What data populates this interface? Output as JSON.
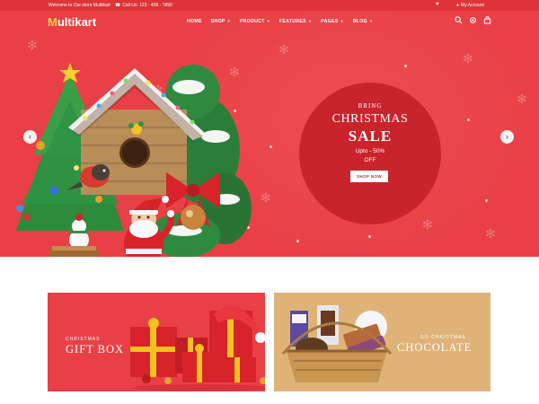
{
  "topbar": {
    "welcome": "Welcome to Our store Multikart",
    "call": "Call Us: 123 - 456 - 7890",
    "account": "My Account"
  },
  "header": {
    "logo_initial": "M",
    "logo_rest": "ultikart",
    "nav": [
      {
        "label": "HOME"
      },
      {
        "label": "SHOP"
      },
      {
        "label": "PRODUCT"
      },
      {
        "label": "FEATURES"
      },
      {
        "label": "PAGES"
      },
      {
        "label": "BLOG"
      }
    ],
    "icons": [
      "search-icon",
      "settings-icon",
      "cart-icon"
    ]
  },
  "hero": {
    "bring": "BRING",
    "christmas": "CHRISTMAS",
    "sale": "SALE",
    "upto": "Upto - 50%",
    "off": "OFF",
    "button": "SHOP NOW",
    "prev": "‹",
    "next": "›"
  },
  "banners": [
    {
      "sub": "CHRISTMAS",
      "title": "GIFT BOX"
    },
    {
      "sub": "GO CHRISTMAS",
      "title": "CHOCOLATE"
    }
  ],
  "colors": {
    "primary": "#e84046",
    "topbar": "#de3338",
    "circle": "#c9242b",
    "tan": "#dfb377"
  }
}
